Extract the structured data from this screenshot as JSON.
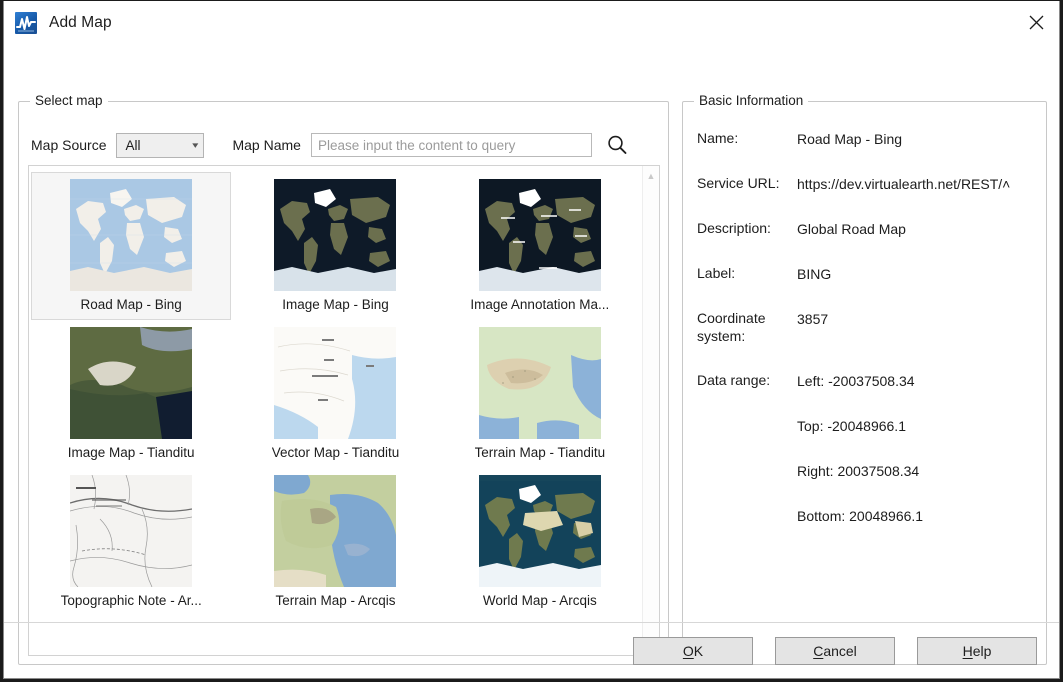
{
  "window": {
    "title": "Add Map",
    "app_icon": "waveform-app-icon",
    "close_label": "close-icon"
  },
  "select_map": {
    "group_title": "Select map",
    "map_source_label": "Map Source",
    "map_source_value": "All",
    "map_source_options": [
      "All"
    ],
    "map_name_label": "Map Name",
    "search_placeholder": "Please input the content to query",
    "search_value": "",
    "search_icon": "magnifier-icon",
    "scroll_up_icon": "chevron-up-icon",
    "scroll_down_icon": "chevron-down-icon",
    "items": [
      {
        "label": "Road Map - Bing",
        "thumb": "world-road",
        "selected": true
      },
      {
        "label": "Image Map - Bing",
        "thumb": "world-satellite",
        "selected": false
      },
      {
        "label": "Image Annotation Ma...",
        "thumb": "world-sat-labels",
        "selected": false
      },
      {
        "label": "Image Map - Tianditu",
        "thumb": "china-satellite",
        "selected": false
      },
      {
        "label": "Vector Map - Tianditu",
        "thumb": "china-vector",
        "selected": false
      },
      {
        "label": "Terrain Map - Tianditu",
        "thumb": "china-terrain",
        "selected": false
      },
      {
        "label": "Topographic Note - Ar...",
        "thumb": "topo-note",
        "selected": false
      },
      {
        "label": "Terrain Map - Arcqis",
        "thumb": "iberia-terrain",
        "selected": false
      },
      {
        "label": "World Map - Arcqis",
        "thumb": "world-physical",
        "selected": false
      }
    ]
  },
  "basic_information": {
    "group_title": "Basic Information",
    "rows": [
      {
        "key": "Name:",
        "value": "Road Map - Bing"
      },
      {
        "key": "Service URL:",
        "value": "https://dev.virtualearth.net/REST/˄"
      },
      {
        "key": "Description:",
        "value": "Global Road Map"
      },
      {
        "key": "Label:",
        "value": "BING"
      },
      {
        "key": "Coordinate system:",
        "value": "3857"
      },
      {
        "key": "Data range:",
        "value": "Left: -20037508.34"
      },
      {
        "key": "",
        "value": "Top: -20048966.1"
      },
      {
        "key": "",
        "value": "Right: 20037508.34"
      },
      {
        "key": "",
        "value": "Bottom: 20048966.1"
      }
    ]
  },
  "footer": {
    "ok": {
      "prefix": "",
      "accel": "O",
      "suffix": "K"
    },
    "cancel": {
      "prefix": "",
      "accel": "C",
      "suffix": "ancel"
    },
    "help": {
      "prefix": "",
      "accel": "H",
      "suffix": "elp"
    }
  },
  "colors": {
    "accent_blue": "#1659a8",
    "group_border": "#c8c8c8",
    "selection_bg": "#f6f6f6",
    "button_face": "#e4e4e4"
  }
}
